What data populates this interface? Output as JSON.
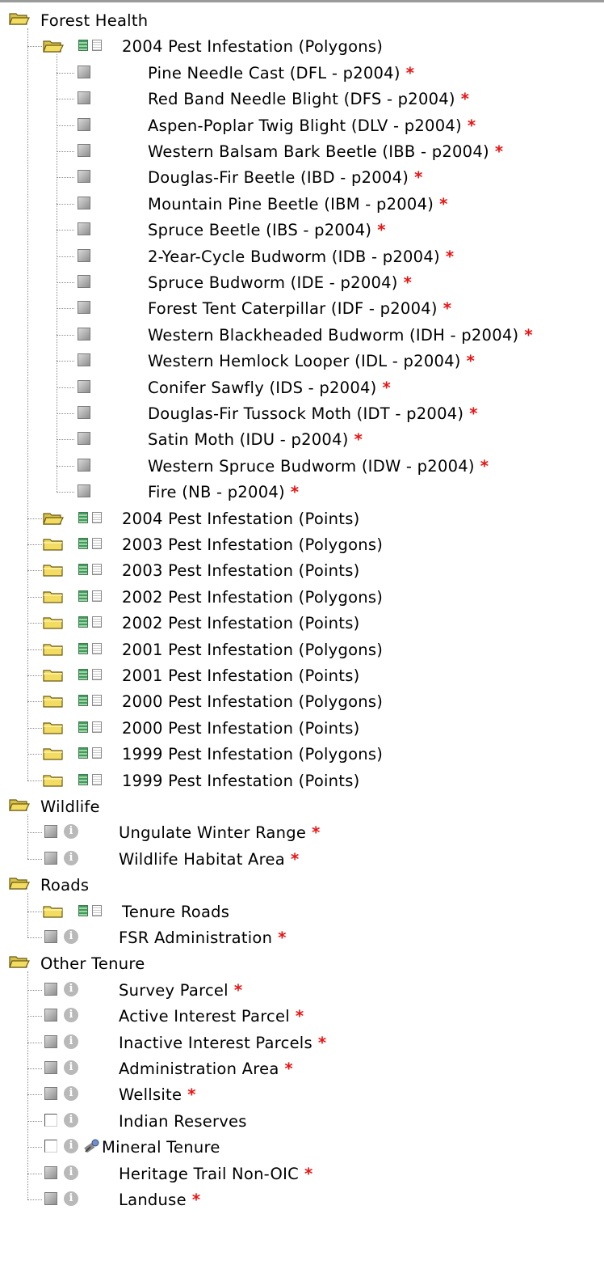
{
  "tree": {
    "groups": [
      {
        "label": "Forest Health",
        "children": [
          {
            "type": "folder",
            "open": true,
            "label": "2004 Pest Infestation (Polygons)",
            "children": [
              {
                "label": "Pine Needle Cast (DFL - p2004)",
                "required": true
              },
              {
                "label": "Red Band Needle Blight (DFS - p2004)",
                "required": true
              },
              {
                "label": "Aspen-Poplar Twig Blight (DLV - p2004)",
                "required": true
              },
              {
                "label": "Western Balsam Bark Beetle (IBB - p2004)",
                "required": true
              },
              {
                "label": "Douglas-Fir Beetle (IBD - p2004)",
                "required": true
              },
              {
                "label": "Mountain Pine Beetle (IBM - p2004)",
                "required": true
              },
              {
                "label": "Spruce Beetle (IBS - p2004)",
                "required": true
              },
              {
                "label": "2-Year-Cycle Budworm (IDB - p2004)",
                "required": true
              },
              {
                "label": "Spruce Budworm (IDE - p2004)",
                "required": true
              },
              {
                "label": "Forest Tent Caterpillar (IDF - p2004)",
                "required": true
              },
              {
                "label": "Western Blackheaded Budworm (IDH - p2004)",
                "required": true
              },
              {
                "label": "Western Hemlock Looper (IDL - p2004)",
                "required": true
              },
              {
                "label": "Conifer Sawfly (IDS - p2004)",
                "required": true
              },
              {
                "label": "Douglas-Fir Tussock Moth (IDT - p2004)",
                "required": true
              },
              {
                "label": "Satin Moth (IDU - p2004)",
                "required": true
              },
              {
                "label": "Western Spruce Budworm (IDW - p2004)",
                "required": true
              },
              {
                "label": "Fire (NB - p2004)",
                "required": true
              }
            ]
          },
          {
            "type": "folder",
            "open": true,
            "label": "2004 Pest Infestation (Points)"
          },
          {
            "type": "folder",
            "open": false,
            "label": "2003 Pest Infestation (Polygons)"
          },
          {
            "type": "folder",
            "open": false,
            "label": "2003 Pest Infestation (Points)"
          },
          {
            "type": "folder",
            "open": false,
            "label": "2002 Pest Infestation (Polygons)"
          },
          {
            "type": "folder",
            "open": false,
            "label": "2002 Pest Infestation (Points)"
          },
          {
            "type": "folder",
            "open": false,
            "label": "2001 Pest Infestation (Polygons)"
          },
          {
            "type": "folder",
            "open": false,
            "label": "2001 Pest Infestation (Points)"
          },
          {
            "type": "folder",
            "open": false,
            "label": "2000 Pest Infestation (Polygons)"
          },
          {
            "type": "folder",
            "open": false,
            "label": "2000 Pest Infestation (Points)"
          },
          {
            "type": "folder",
            "open": false,
            "label": "1999 Pest Infestation (Polygons)"
          },
          {
            "type": "folder",
            "open": false,
            "label": "1999 Pest Infestation (Points)"
          }
        ]
      },
      {
        "label": "Wildlife",
        "children": [
          {
            "type": "layer",
            "checkbox": "disabled",
            "info": true,
            "label": "Ungulate Winter Range",
            "required": true
          },
          {
            "type": "layer",
            "checkbox": "disabled",
            "info": true,
            "label": "Wildlife Habitat Area",
            "required": true
          }
        ]
      },
      {
        "label": "Roads",
        "children": [
          {
            "type": "folder",
            "open": false,
            "label": "Tenure Roads"
          },
          {
            "type": "layer",
            "checkbox": "disabled",
            "info": true,
            "label": "FSR Administration",
            "required": true
          }
        ]
      },
      {
        "label": "Other Tenure",
        "children": [
          {
            "type": "layer",
            "checkbox": "disabled",
            "info": true,
            "label": "Survey Parcel",
            "required": true
          },
          {
            "type": "layer",
            "checkbox": "disabled",
            "info": true,
            "label": "Active Interest Parcel",
            "required": true
          },
          {
            "type": "layer",
            "checkbox": "disabled",
            "info": true,
            "label": "Inactive Interest Parcels",
            "required": true
          },
          {
            "type": "layer",
            "checkbox": "disabled",
            "info": true,
            "label": "Administration Area",
            "required": true
          },
          {
            "type": "layer",
            "checkbox": "disabled",
            "info": true,
            "label": "Wellsite",
            "required": true
          },
          {
            "type": "layer",
            "checkbox": "unchecked",
            "info": true,
            "label": "Indian Reserves",
            "required": false
          },
          {
            "type": "layer",
            "checkbox": "unchecked",
            "info": true,
            "tool": true,
            "label": "Mineral Tenure",
            "required": false
          },
          {
            "type": "layer",
            "checkbox": "disabled",
            "info": true,
            "label": "Heritage Trail Non-OIC",
            "required": true
          },
          {
            "type": "layer",
            "checkbox": "disabled",
            "info": true,
            "label": "Landuse",
            "required": true
          }
        ]
      }
    ],
    "required_mark": "*",
    "info_glyph": "i",
    "icons": {
      "group": "open-folder-icon",
      "folder_open": "open-folder-icon",
      "folder_closed": "closed-folder-icon",
      "legend_on": "legend-green-icon",
      "legend_off": "legend-white-icon",
      "info": "info-icon",
      "tool": "identify-tool-icon"
    },
    "colors": {
      "required_star": "#ee1111",
      "folder_fill": "#f2dc62",
      "folder_edge": "#6b5a10",
      "tree_line": "#8c8c8c"
    }
  }
}
